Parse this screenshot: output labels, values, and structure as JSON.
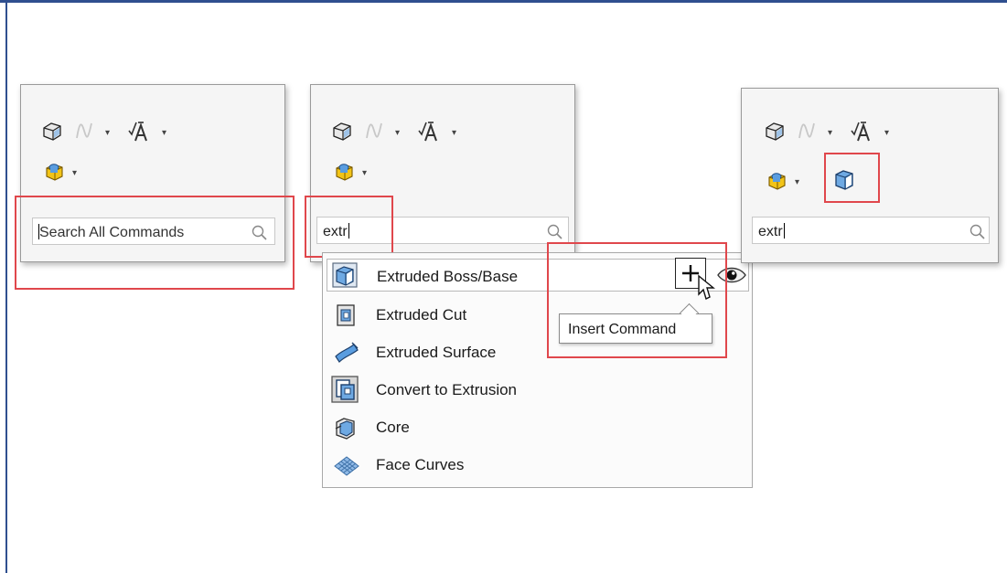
{
  "panels": [
    {
      "search_value": "",
      "search_placeholder": "Search All Commands"
    },
    {
      "search_value": "extr",
      "search_placeholder": ""
    },
    {
      "search_value": "extr",
      "search_placeholder": ""
    }
  ],
  "toolbar_icons": [
    "part-icon",
    "curve-icon",
    "text-annotation-icon",
    "features-icon"
  ],
  "dropdown": {
    "items": [
      {
        "label": "Extruded Boss/Base",
        "icon": "extruded-boss-icon"
      },
      {
        "label": "Extruded Cut",
        "icon": "extruded-cut-icon"
      },
      {
        "label": "Extruded Surface",
        "icon": "extruded-surface-icon"
      },
      {
        "label": "Convert to Extrusion",
        "icon": "convert-extrusion-icon"
      },
      {
        "label": "Core",
        "icon": "core-icon"
      },
      {
        "label": "Face Curves",
        "icon": "face-curves-icon"
      }
    ]
  },
  "tooltip": {
    "text": "Insert Command"
  },
  "colors": {
    "highlight_box": "#e0474c",
    "frame": "#2f4f8f",
    "icon_blue": "#4a86c8",
    "icon_yellow": "#e8b318"
  }
}
